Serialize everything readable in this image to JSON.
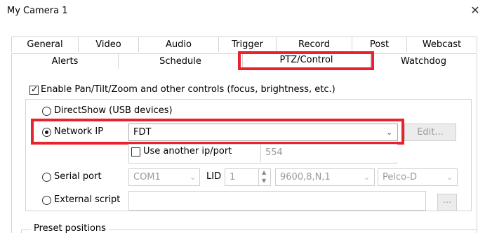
{
  "window": {
    "title": "My Camera 1",
    "close_glyph": "✕"
  },
  "tabs_row1": [
    {
      "label": "General"
    },
    {
      "label": "Video"
    },
    {
      "label": "Audio"
    },
    {
      "label": "Trigger"
    },
    {
      "label": "Record"
    },
    {
      "label": "Post"
    },
    {
      "label": "Webcast"
    }
  ],
  "tabs_row2": [
    {
      "label": "Alerts"
    },
    {
      "label": "Schedule"
    },
    {
      "label": "PTZ/Control",
      "selected": true
    },
    {
      "label": "Watchdog"
    }
  ],
  "ptz": {
    "enable_label": "Enable Pan/Tilt/Zoom and other controls (focus, brightness, etc.)",
    "enable_checked": true,
    "directshow_label": "DirectShow (USB devices)",
    "network_ip_label": "Network IP",
    "network_ip_value": "FDT",
    "edit_label": "Edit...",
    "use_another_label": "Use another ip/port",
    "port_placeholder": "554",
    "serial_port_label": "Serial port",
    "serial_port_value": "COM1",
    "lid_label": "LID",
    "lid_value": "1",
    "baud_value": "9600,8,N,1",
    "protocol_value": "Pelco-D",
    "external_script_label": "External script",
    "browse_label": "...",
    "preset_positions_label": "Preset positions"
  },
  "colors": {
    "highlight": "#e8232e",
    "border": "#d4d4d4",
    "disabled_text": "#9a9a9a"
  }
}
